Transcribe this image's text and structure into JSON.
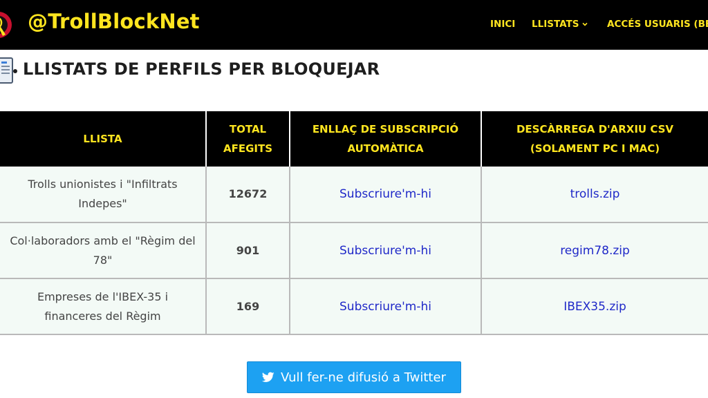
{
  "header": {
    "brand": "@TrollBlockNet",
    "nav": {
      "inici": "INICI",
      "llistats": "LLISTATS",
      "acces": "ACCÉS USUARIS (BETA)"
    },
    "logo_icon": "ribbon-badge-icon",
    "colors": {
      "bar": "#000000",
      "accent": "#ffe51f"
    }
  },
  "page": {
    "title": "LLISTATS DE PERFILS PER BLOQUEJAR",
    "title_icon": "document-icon"
  },
  "table": {
    "headers": {
      "llista": "LLISTA",
      "total": "TOTAL AFEGITS",
      "enllac": "ENLLAÇ DE SUBSCRIPCIÓ AUTOMÀTICA",
      "descarrega": "DESCÀRREGA D'ARXIU CSV (SOLAMENT PC I MAC)"
    },
    "rows": [
      {
        "name": "Trolls unionistes i \"Infiltrats Indepes\"",
        "total": "12672",
        "subscribe": "Subscriure'm-hi",
        "file": "trolls.zip"
      },
      {
        "name": "Col·laboradors amb el \"Règim del 78\"",
        "total": "901",
        "subscribe": "Subscriure'm-hi",
        "file": "regim78.zip"
      },
      {
        "name": "Empreses de l'IBEX-35 i financeres del Règim",
        "total": "169",
        "subscribe": "Subscriure'm-hi",
        "file": "IBEX35.zip"
      }
    ]
  },
  "share": {
    "label": "Vull fer-ne difusió a Twitter",
    "icon": "twitter-bird-icon",
    "color": "#1da1f2"
  }
}
